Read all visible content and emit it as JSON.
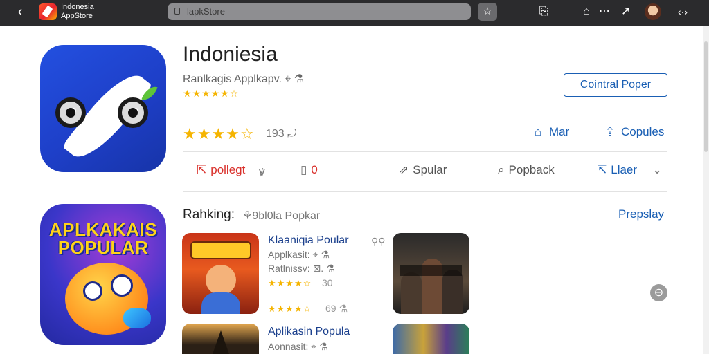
{
  "topbar": {
    "back_glyph": "‹",
    "brand_line1": "Indonesia",
    "brand_line2": "AppStore",
    "url": "lapkStore",
    "bookmark_glyph": "☆",
    "icons": [
      "share-icon",
      "download-icon",
      "more-icon",
      "play-icon",
      "avatar",
      "menu-icon"
    ],
    "share_glyph": "⎘",
    "home_glyph": "⌂",
    "more_glyph": "⋯",
    "send_glyph": "➚",
    "menu_glyph": "‹·›"
  },
  "app": {
    "title": "Indoniesia",
    "subtitle": "Ranlkagis Applkapv. ⌖ ⚗",
    "stars_small": "★★★★★☆",
    "contact_label": "Cointral Poper",
    "stars_big": "★★★★☆",
    "rating_count": "193 ⤾",
    "accent": "#1a5fb4",
    "star_color": "#f5b400"
  },
  "actions_top": [
    {
      "label": "Mar",
      "icon": "⌂"
    },
    {
      "label": "Copules",
      "icon": "⇪"
    }
  ],
  "actions_row": [
    {
      "label": "pollegt",
      "icon": "⇱",
      "extra": "ꝟ"
    },
    {
      "label": "0",
      "icon": "▯"
    },
    {
      "label": "Spular",
      "icon": "⇗"
    },
    {
      "label": "Popback",
      "icon": "⌕"
    },
    {
      "label": "Llaer",
      "icon": "⇱",
      "extra": "⌄"
    }
  ],
  "ranking": {
    "title": "Rahking:",
    "subtitle": "⚘9bl0la Popkar",
    "link": "Prepslay"
  },
  "second_icon": {
    "line1": "APLKAKAIS",
    "line2": "POPULAR"
  },
  "items": [
    {
      "title": "Klaaniqia Poular",
      "corner": "⚲⚲",
      "line1": "Applkasit: ⌖ ⚗",
      "line2": "Ratlnissv: ⊠. ⚗",
      "stars": "★★★★☆",
      "num": "30",
      "stars2": "★★★★☆",
      "num2": "69 ⚗"
    },
    {
      "title": "Aplikasin Popula",
      "line1": "Aonnasit: ⌖ ⚗"
    }
  ],
  "float_glyph": "⊖"
}
